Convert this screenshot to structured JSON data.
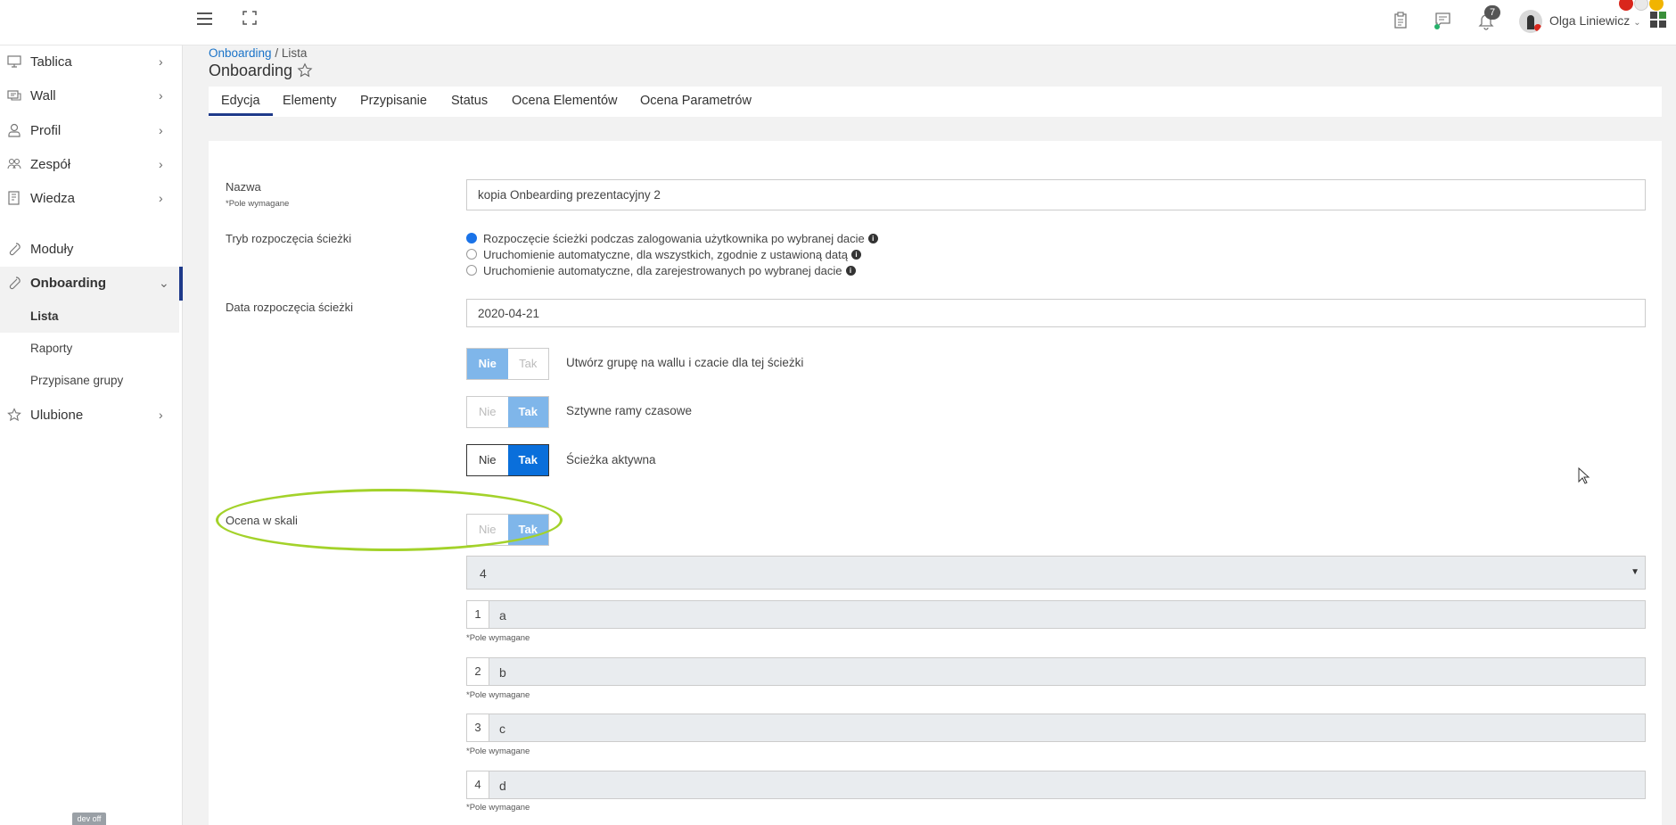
{
  "topbar": {
    "notification_count": "7",
    "user_name": "Olga Liniewicz",
    "icons": [
      "menu-icon",
      "fullscreen-icon",
      "clipboard-icon",
      "chat-icon",
      "bell-icon",
      "apps-icon"
    ],
    "flag_colors": [
      "#d9261c",
      "#e0e0e0",
      "#f1b400"
    ]
  },
  "sidebar": {
    "items": [
      {
        "label": "Tablica",
        "icon": "monitor-icon"
      },
      {
        "label": "Wall",
        "icon": "wall-icon"
      },
      {
        "label": "Profil",
        "icon": "user-icon"
      },
      {
        "label": "Zespół",
        "icon": "team-icon"
      },
      {
        "label": "Wiedza",
        "icon": "book-icon"
      },
      {
        "label": "Moduły",
        "icon": "wrench-icon"
      },
      {
        "label": "Onboarding",
        "icon": "wrench-icon"
      },
      {
        "label": "Ulubione",
        "icon": "star-icon"
      }
    ],
    "sub_items": [
      "Lista",
      "Raporty",
      "Przypisane grupy"
    ],
    "dev_badge": "dev off"
  },
  "breadcrumb": {
    "link": "Onboarding",
    "separator": "/",
    "current": "Lista"
  },
  "page_title": "Onboarding",
  "tabs": [
    "Edycja",
    "Elementy",
    "Przypisanie",
    "Status",
    "Ocena Elementów",
    "Ocena Parametrów"
  ],
  "form": {
    "name_label": "Nazwa",
    "required_note": "*Pole wymagane",
    "name_value": "kopia Onbearding prezentacyjny 2",
    "start_mode_label": "Tryb rozpoczęcia ścieżki",
    "start_mode_options": [
      "Rozpoczęcie ścieżki podczas zalogowania użytkownika po wybranej dacie",
      "Uruchomienie automatyczne, dla wszystkich, zgodnie z ustawioną datą",
      "Uruchomienie automatyczne, dla zarejestrowanych po wybranej dacie"
    ],
    "start_mode_selected": 0,
    "date_label": "Data rozpoczęcia ścieżki",
    "date_value": "2020-04-21",
    "toggle_no": "Nie",
    "toggle_yes": "Tak",
    "toggles": [
      {
        "label": "Utwórz grupę na wallu i czacie dla tej ścieżki",
        "value": "Nie"
      },
      {
        "label": "Sztywne ramy czasowe",
        "value": "Tak"
      },
      {
        "label": "Ścieżka aktywna",
        "value": "Tak"
      }
    ],
    "scale_label": "Ocena w skali",
    "scale_toggle_value": "Tak",
    "scale_select_value": "4",
    "scale_rows": [
      {
        "num": "1",
        "value": "a"
      },
      {
        "num": "2",
        "value": "b"
      },
      {
        "num": "3",
        "value": "c"
      },
      {
        "num": "4",
        "value": "d"
      }
    ]
  }
}
